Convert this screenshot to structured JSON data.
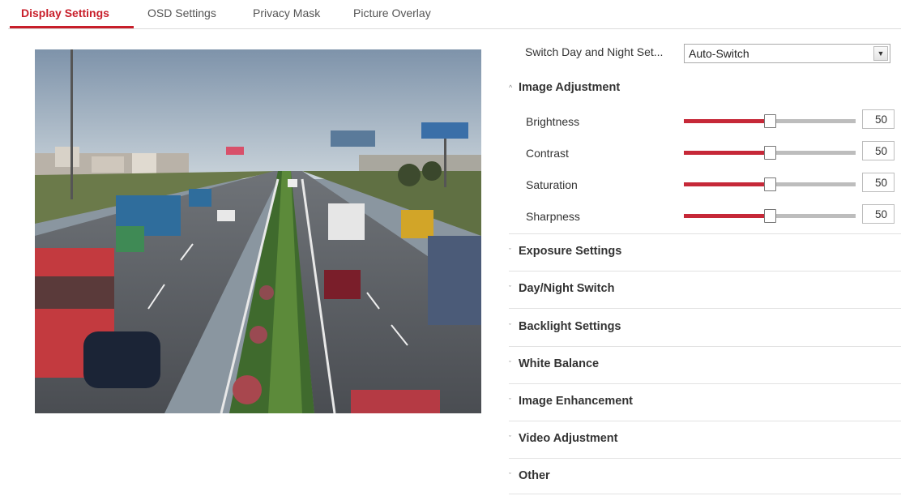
{
  "tabs": [
    {
      "label": "Display Settings",
      "active": true
    },
    {
      "label": "OSD Settings",
      "active": false
    },
    {
      "label": "Privacy Mask",
      "active": false
    },
    {
      "label": "Picture Overlay",
      "active": false
    }
  ],
  "day_night": {
    "label": "Switch Day and Night Set...",
    "value": "Auto-Switch"
  },
  "image_adjustment": {
    "title": "Image Adjustment",
    "icon": "chevron-up-icon",
    "sliders": [
      {
        "label": "Brightness",
        "value": "50",
        "fraction": 0.5
      },
      {
        "label": "Contrast",
        "value": "50",
        "fraction": 0.5
      },
      {
        "label": "Saturation",
        "value": "50",
        "fraction": 0.5
      },
      {
        "label": "Sharpness",
        "value": "50",
        "fraction": 0.5
      }
    ]
  },
  "sections": [
    {
      "title": "Exposure Settings",
      "icon": "chevron-down-icon"
    },
    {
      "title": "Day/Night Switch",
      "icon": "chevron-down-icon"
    },
    {
      "title": "Backlight Settings",
      "icon": "chevron-down-icon"
    },
    {
      "title": "White Balance",
      "icon": "chevron-down-icon"
    },
    {
      "title": "Image Enhancement",
      "icon": "chevron-down-icon"
    },
    {
      "title": "Video Adjustment",
      "icon": "chevron-down-icon"
    },
    {
      "title": "Other",
      "icon": "chevron-down-icon"
    }
  ],
  "colors": {
    "accent": "#c81e2a",
    "slider_fill": "#c62838",
    "slider_track": "#bdbdbd"
  }
}
